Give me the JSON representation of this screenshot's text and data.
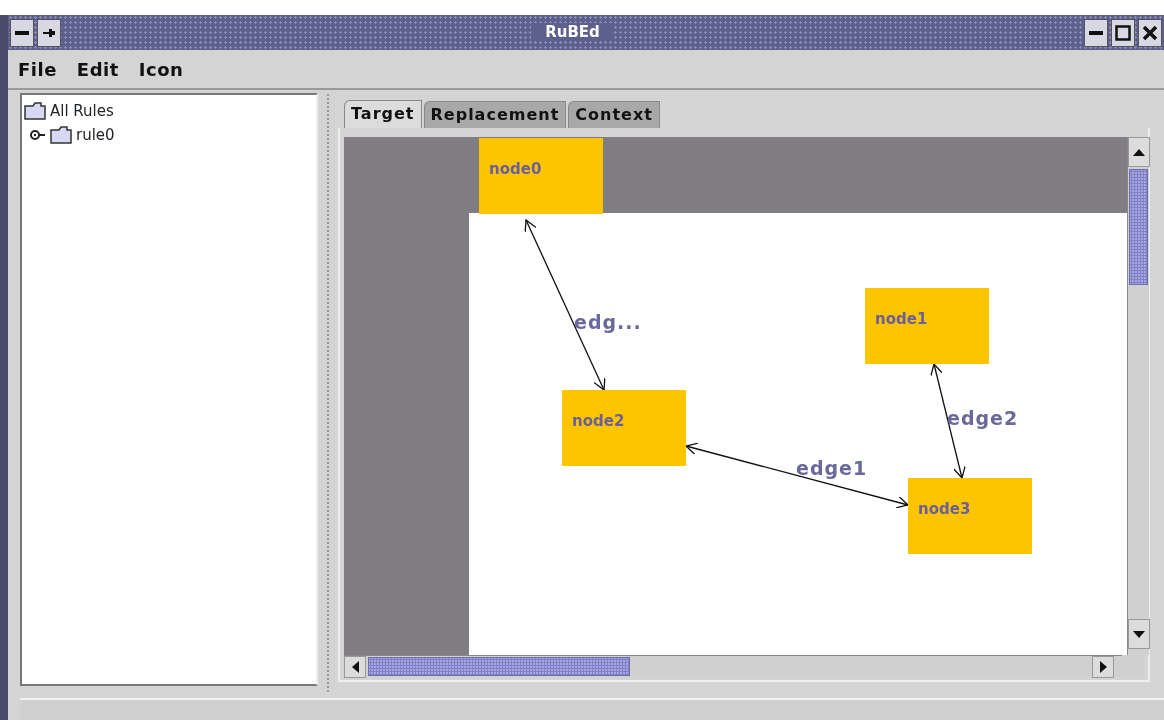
{
  "window": {
    "title": "RuBEd"
  },
  "menu": [
    "File",
    "Edit",
    "Icon"
  ],
  "tree": {
    "label": "All Rules",
    "children": [
      {
        "label": "rule0",
        "expanded": false
      }
    ]
  },
  "tabs": [
    {
      "label": "Target",
      "selected": true
    },
    {
      "label": "Replacement",
      "selected": false
    },
    {
      "label": "Context",
      "selected": false
    }
  ],
  "canvas": {
    "nodes": [
      {
        "label": "node0"
      },
      {
        "label": "node1"
      },
      {
        "label": "node2"
      },
      {
        "label": "node3"
      }
    ],
    "edges": [
      {
        "label": "edg..."
      },
      {
        "label": "edge1"
      },
      {
        "label": "edge2"
      }
    ]
  }
}
